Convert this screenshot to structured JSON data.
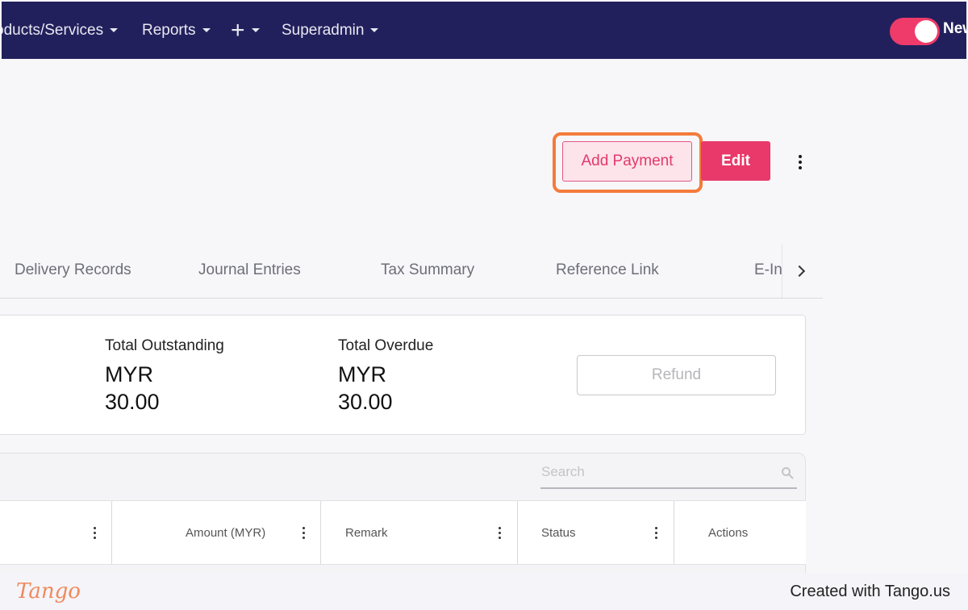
{
  "navbar": {
    "items": [
      {
        "label": "oducts/Services",
        "has_caret": true
      },
      {
        "label": "Reports",
        "has_caret": true
      },
      {
        "label": "+",
        "has_caret": true
      },
      {
        "label": "Superadmin",
        "has_caret": true
      }
    ],
    "toggle_label": "New",
    "toggle_on": true,
    "colors": {
      "background": "#22205c",
      "toggle": "#ee3b6a"
    }
  },
  "actions": {
    "add_payment_label": "Add Payment",
    "edit_label": "Edit",
    "more_icon": "more-vertical-icon",
    "accent_color": "#e8396a"
  },
  "tabs": {
    "items": [
      "Delivery Records",
      "Journal Entries",
      "Tax Summary",
      "Reference Link",
      "E-Inv"
    ],
    "scroll_icon": "chevron-right-icon"
  },
  "summary": {
    "outstanding_label": "Total Outstanding",
    "outstanding_currency": "MYR",
    "outstanding_amount": "30.00",
    "overdue_label": "Total Overdue",
    "overdue_currency": "MYR",
    "overdue_amount": "30.00",
    "refund_label": "Refund"
  },
  "table": {
    "search_placeholder": "Search",
    "columns": [
      "",
      "Amount (MYR)",
      "Remark",
      "Status",
      "Actions"
    ]
  },
  "footer": {
    "logo_text": "Tango",
    "credit": "Created with Tango.us"
  }
}
